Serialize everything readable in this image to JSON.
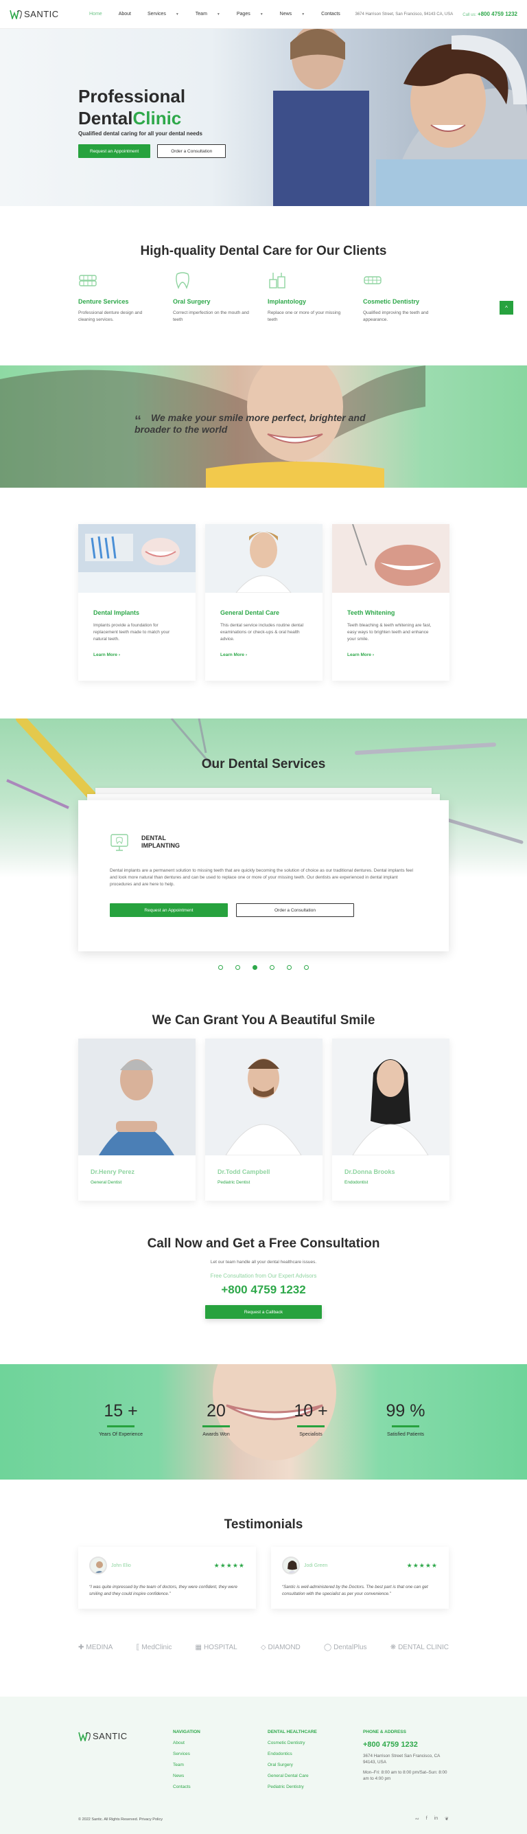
{
  "header": {
    "logo": "SANTIC",
    "nav": [
      {
        "label": "Home",
        "active": true,
        "dropdown": false
      },
      {
        "label": "About",
        "active": false,
        "dropdown": false
      },
      {
        "label": "Services",
        "active": false,
        "dropdown": true
      },
      {
        "label": "Team",
        "active": false,
        "dropdown": true
      },
      {
        "label": "Pages",
        "active": false,
        "dropdown": true
      },
      {
        "label": "News",
        "active": false,
        "dropdown": true
      },
      {
        "label": "Contacts",
        "active": false,
        "dropdown": false
      }
    ],
    "address": "3674 Harrison Street, San Francisco, 94143 CA, USA",
    "call_label": "Call us:",
    "phone": "+800 4759 1232"
  },
  "hero": {
    "title_line1": "Professional",
    "title_line2_a": "Dental",
    "title_line2_b": "Clinic",
    "subtitle": "Qualified dental caring for all your dental needs",
    "btn_primary": "Request an Appointment",
    "btn_secondary": "Order a Consultation"
  },
  "care": {
    "title": "High-quality Dental Care for Our Clients",
    "items": [
      {
        "title": "Denture Services",
        "text": "Professional denture design and cleaning services.",
        "icon": "denture-icon"
      },
      {
        "title": "Oral Surgery",
        "text": "Correct imperfection on the mouth and teeth",
        "icon": "tooth-icon"
      },
      {
        "title": "Implantology",
        "text": "Replace one or more of your missing teeth",
        "icon": "implant-icon"
      },
      {
        "title": "Cosmetic Dentistry",
        "text": "Qualified improving the teeth and appearance.",
        "icon": "braces-icon"
      }
    ],
    "scroll_top": "^"
  },
  "quote": {
    "mark": "“",
    "text": "We make your smile more perfect, brighter and broader to the world"
  },
  "cards": [
    {
      "title": "Dental Implants",
      "text": "Implants provide a foundation for replacement teeth made to match your natural teeth.",
      "more": "Learn More"
    },
    {
      "title": "General Dental Care",
      "text": "This dental service includes routine dental examinations or check-ups & oral health advice.",
      "more": "Learn More"
    },
    {
      "title": "Teeth Whitening",
      "text": "Teeth bleaching & teeth whitening are fast, easy ways to brighten teeth and enhance your smile.",
      "more": "Learn More"
    }
  ],
  "dental_services": {
    "title": "Our Dental Services",
    "card_title": "DENTAL IMPLANTING",
    "card_text": "Dental implants are a permanent solution to missing teeth that are quickly becoming the solution of choice as our traditional dentures. Dental implants feel and look more natural than dentures and can be used to replace one or more of your missing teeth. Our dentists are experienced in dental implant procedures and are here to help.",
    "btn_primary": "Request an Appointment",
    "btn_secondary": "Order a Consultation",
    "slides": 6,
    "active_slide": 3
  },
  "team": {
    "title": "We Can Grant You A Beautiful Smile",
    "members": [
      {
        "name": "Dr.Henry Perez",
        "role": "General Dentist"
      },
      {
        "name": "Dr.Todd Campbell",
        "role": "Pediatric Dentist"
      },
      {
        "name": "Dr.Donna Brooks",
        "role": "Endodontist"
      }
    ]
  },
  "consultation": {
    "title": "Call Now and Get a Free Consultation",
    "subtitle": "Let our team handle all your dental healthcare issues.",
    "tagline": "Free Consultation from Our Expert Advisors",
    "phone": "+800 4759 1232",
    "button": "Request a Callback"
  },
  "stats": [
    {
      "value": "15 +",
      "label": "Years Of Experience"
    },
    {
      "value": "20",
      "label": "Awards Won"
    },
    {
      "value": "10 +",
      "label": "Specialists"
    },
    {
      "value": "99 %",
      "label": "Satisfied Patients"
    }
  ],
  "testimonials": {
    "title": "Testimonials",
    "items": [
      {
        "name": "John Elio",
        "rating": 5,
        "stars": "★★★★★",
        "text": "“I was quite impressed by the team of doctors, they were confident, they were smiling and they could inspire confidence.”"
      },
      {
        "name": "Jodi Green",
        "rating": 5,
        "stars": "★★★★★",
        "text": "“Santic is well-administered by the Doctors. The best part is that one can get consultation with the specialist as per your convenience.”"
      }
    ]
  },
  "brands": [
    {
      "name": "MEDINA",
      "icon": "cross-icon"
    },
    {
      "name": "MedClinic",
      "icon": "bracket-icon"
    },
    {
      "name": "HOSPITAL",
      "icon": "h-icon"
    },
    {
      "name": "DIAMOND",
      "icon": "diamond-icon"
    },
    {
      "name": "DentalPlus",
      "icon": "circle-icon"
    },
    {
      "name": "DENTAL CLINIC",
      "icon": "tooth-icon"
    }
  ],
  "footer": {
    "logo": "SANTIC",
    "nav_title": "NAVIGATION",
    "nav": [
      "About",
      "Services",
      "Team",
      "News",
      "Contacts"
    ],
    "health_title": "DENTAL HEALTHCARE",
    "health": [
      "Cosmetic Dentistry",
      "Endodontics",
      "Oral Surgery",
      "General Dental Care",
      "Pediatric Dentistry"
    ],
    "contact_title": "PHONE & ADDRESS",
    "phone": "+800 4759 1232",
    "address": "3674 Harrison Street San Francisco, CA 94143, USA",
    "hours": "Mon–Fri: 8:00 am to 8:00 pm/Sat–Sun: 8:00 am to 4:00 pm",
    "copyright": "© 2022 Santic. All Rights Reserved. Privacy Policy",
    "social": [
      "rss-icon",
      "facebook-icon",
      "linkedin-icon",
      "twitter-icon"
    ]
  },
  "colors": {
    "accent": "#2ea84a",
    "accent_light": "#8fd4a0",
    "band": "#8ed9a3"
  }
}
